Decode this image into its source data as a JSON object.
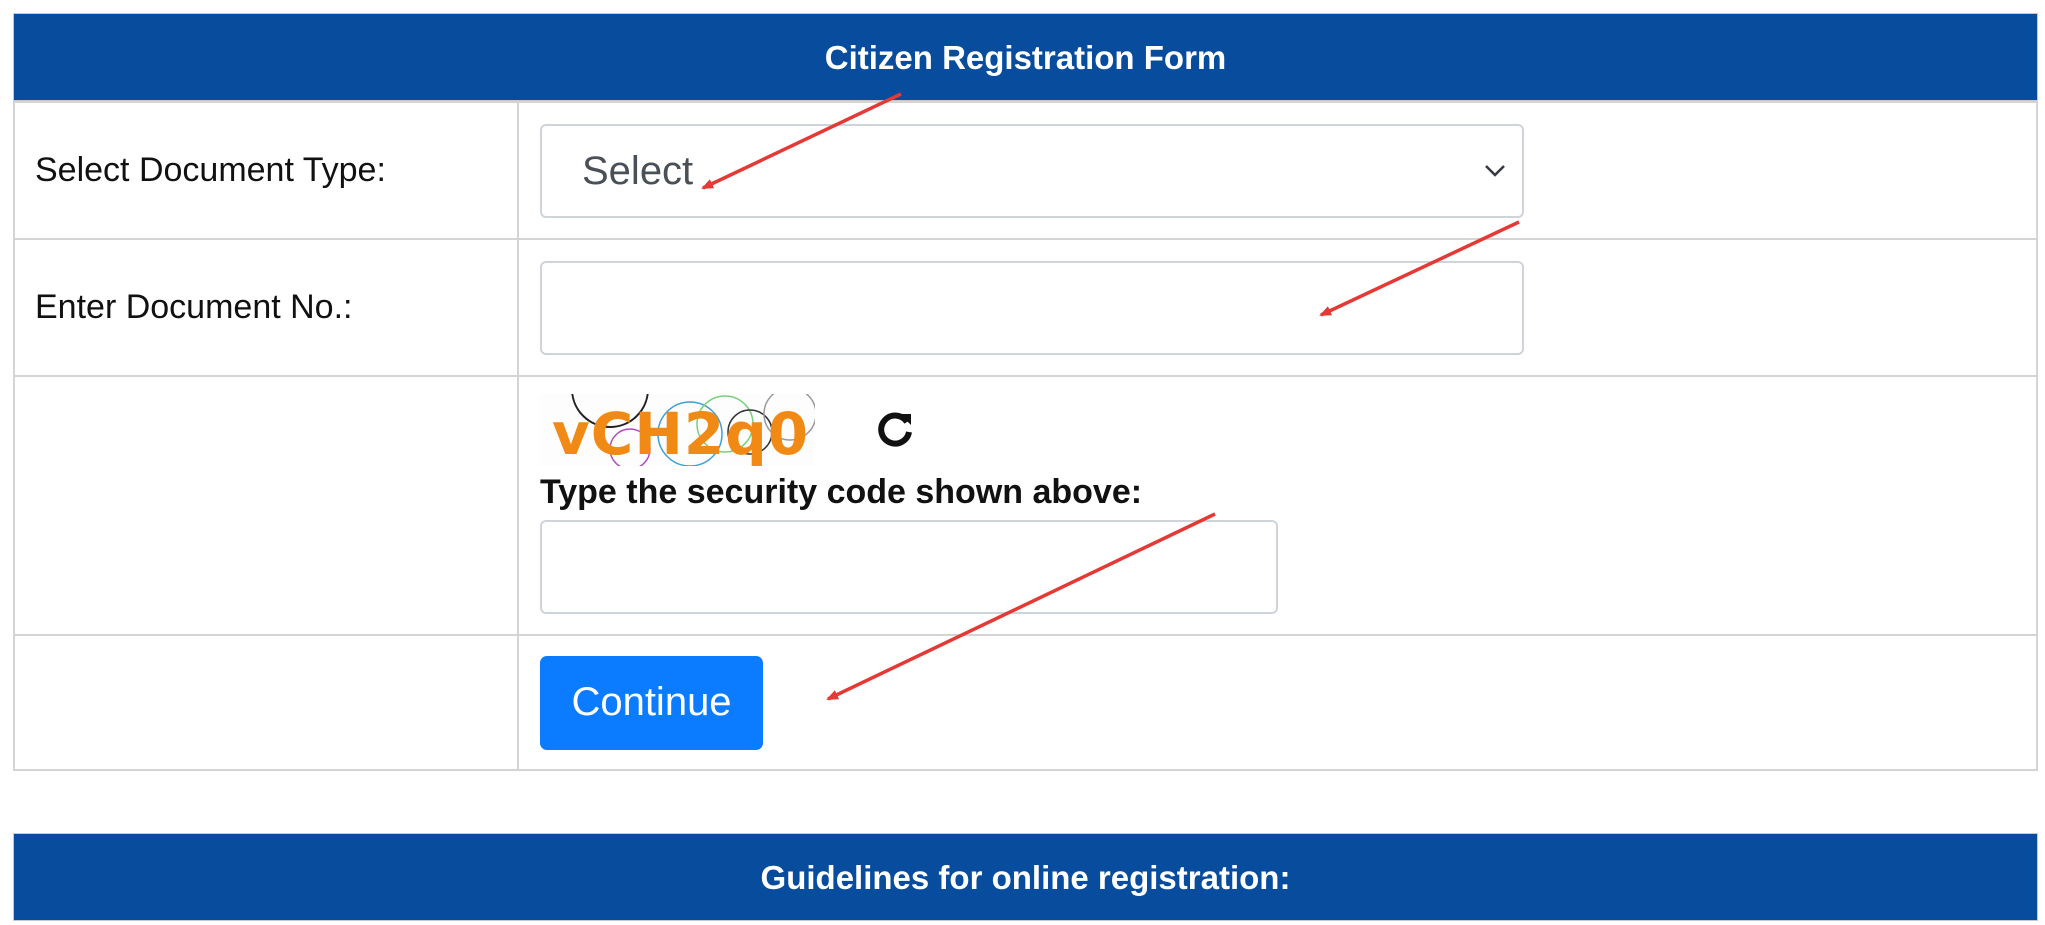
{
  "form": {
    "title": "Citizen Registration Form",
    "document_type_label": "Select Document Type:",
    "document_type_value": "Select",
    "document_no_label": "Enter Document No.:",
    "document_no_value": "",
    "captcha_code": "vCH2q0",
    "captcha_label": "Type the security code shown above:",
    "captcha_value": "",
    "continue_label": "Continue"
  },
  "guidelines": {
    "title": "Guidelines for online registration:"
  },
  "colors": {
    "header_bg": "#084c9e",
    "button_bg": "#0b7bff",
    "annotation_arrow": "#e53935",
    "captcha_text": "#f08a14"
  },
  "icons": {
    "dropdown": "chevron-down-icon",
    "refresh": "refresh-icon"
  }
}
